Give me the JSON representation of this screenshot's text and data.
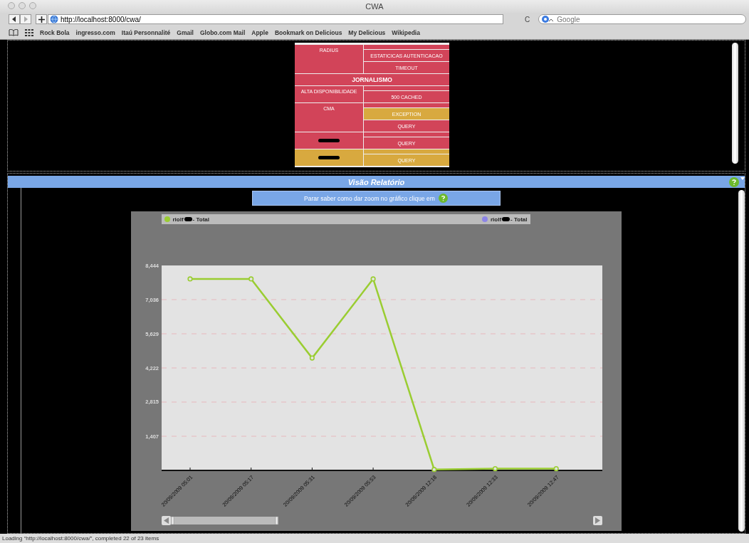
{
  "window": {
    "title": "CWA"
  },
  "toolbar": {
    "url": "http://localhost:8000/cwa/",
    "reload": "C",
    "search_placeholder": "Google"
  },
  "bookmarks": [
    "Rock Bola",
    "ingresso.com",
    "Itaú Personnalité",
    "Gmail",
    "Globo.com Mail",
    "Apple",
    "Bookmark on Delicious",
    "My Delicious",
    "Wikipedia"
  ],
  "top_panel": {
    "rows": [
      {
        "kind": "group",
        "label": "RADIUS",
        "redacted": false,
        "color": "#d24459",
        "cells": [
          {
            "kind": "blank",
            "color": "#d24459"
          },
          {
            "kind": "text",
            "label": "ESTATICICAS AUTENTICACAO",
            "color": "#d24459"
          },
          {
            "kind": "text",
            "label": "TIMEOUT",
            "color": "#d24459"
          }
        ]
      },
      {
        "kind": "section",
        "label": "JORNALISMO",
        "color": "#d24459"
      },
      {
        "kind": "group",
        "label": "ALTA DISPONIBILIDADE",
        "redacted": false,
        "color": "#d24459",
        "cells": [
          {
            "kind": "blank",
            "color": "#d24459"
          },
          {
            "kind": "text",
            "label": "500 CACHED",
            "color": "#d24459"
          }
        ]
      },
      {
        "kind": "group",
        "label": "CMA",
        "redacted": false,
        "color": "#d24459",
        "cells": [
          {
            "kind": "blank",
            "color": "#d24459"
          },
          {
            "kind": "text",
            "label": "EXCEPTION",
            "color": "#d8a93f"
          },
          {
            "kind": "text",
            "label": "QUERY",
            "color": "#d24459"
          }
        ]
      },
      {
        "kind": "group",
        "redacted": true,
        "color": "#d24459",
        "cells": [
          {
            "kind": "blank",
            "color": "#d24459"
          },
          {
            "kind": "text",
            "label": "QUERY",
            "color": "#d24459"
          }
        ]
      },
      {
        "kind": "group",
        "redacted": true,
        "color": "#d8a93f",
        "cells": [
          {
            "kind": "blank",
            "color": "#d8a93f"
          },
          {
            "kind": "text",
            "label": "QUERY",
            "color": "#d8a93f"
          }
        ]
      }
    ]
  },
  "report_panel": {
    "title": "Visão Relatório",
    "hint": "Parar saber como dar zoom no gráfico clique em",
    "legend": [
      {
        "name_start": "riolf",
        "name_end": "- Total",
        "color": "#9acd32"
      },
      {
        "name_start": "riolf",
        "name_end": "- Total",
        "color": "#8c84e6"
      }
    ],
    "chart_data": {
      "type": "line",
      "categories": [
        "20/09/2009 05:01",
        "20/09/2009 05:17",
        "20/09/2009 05:31",
        "20/09/2009 05:53",
        "20/09/2009 12:18",
        "20/09/2009 12:33",
        "20/09/2009 12:47"
      ],
      "series": [
        {
          "color": "#9acd32",
          "values": [
            7890,
            7890,
            4630,
            7890,
            40,
            70,
            70
          ],
          "marker": true
        }
      ],
      "grid": true,
      "ylim": [
        0,
        8444
      ],
      "yticks": [
        {
          "value": 1407,
          "label": "1,407"
        },
        {
          "value": 2815,
          "label": "2,815"
        },
        {
          "value": 4222,
          "label": "4,222"
        },
        {
          "value": 5629,
          "label": "5,629"
        },
        {
          "value": 7036,
          "label": "7,036"
        },
        {
          "value": 8444,
          "label": "8,444"
        }
      ]
    }
  },
  "status_bar": "Loading “http://localhost:8000/cwa/”, completed 22 of 23 items"
}
